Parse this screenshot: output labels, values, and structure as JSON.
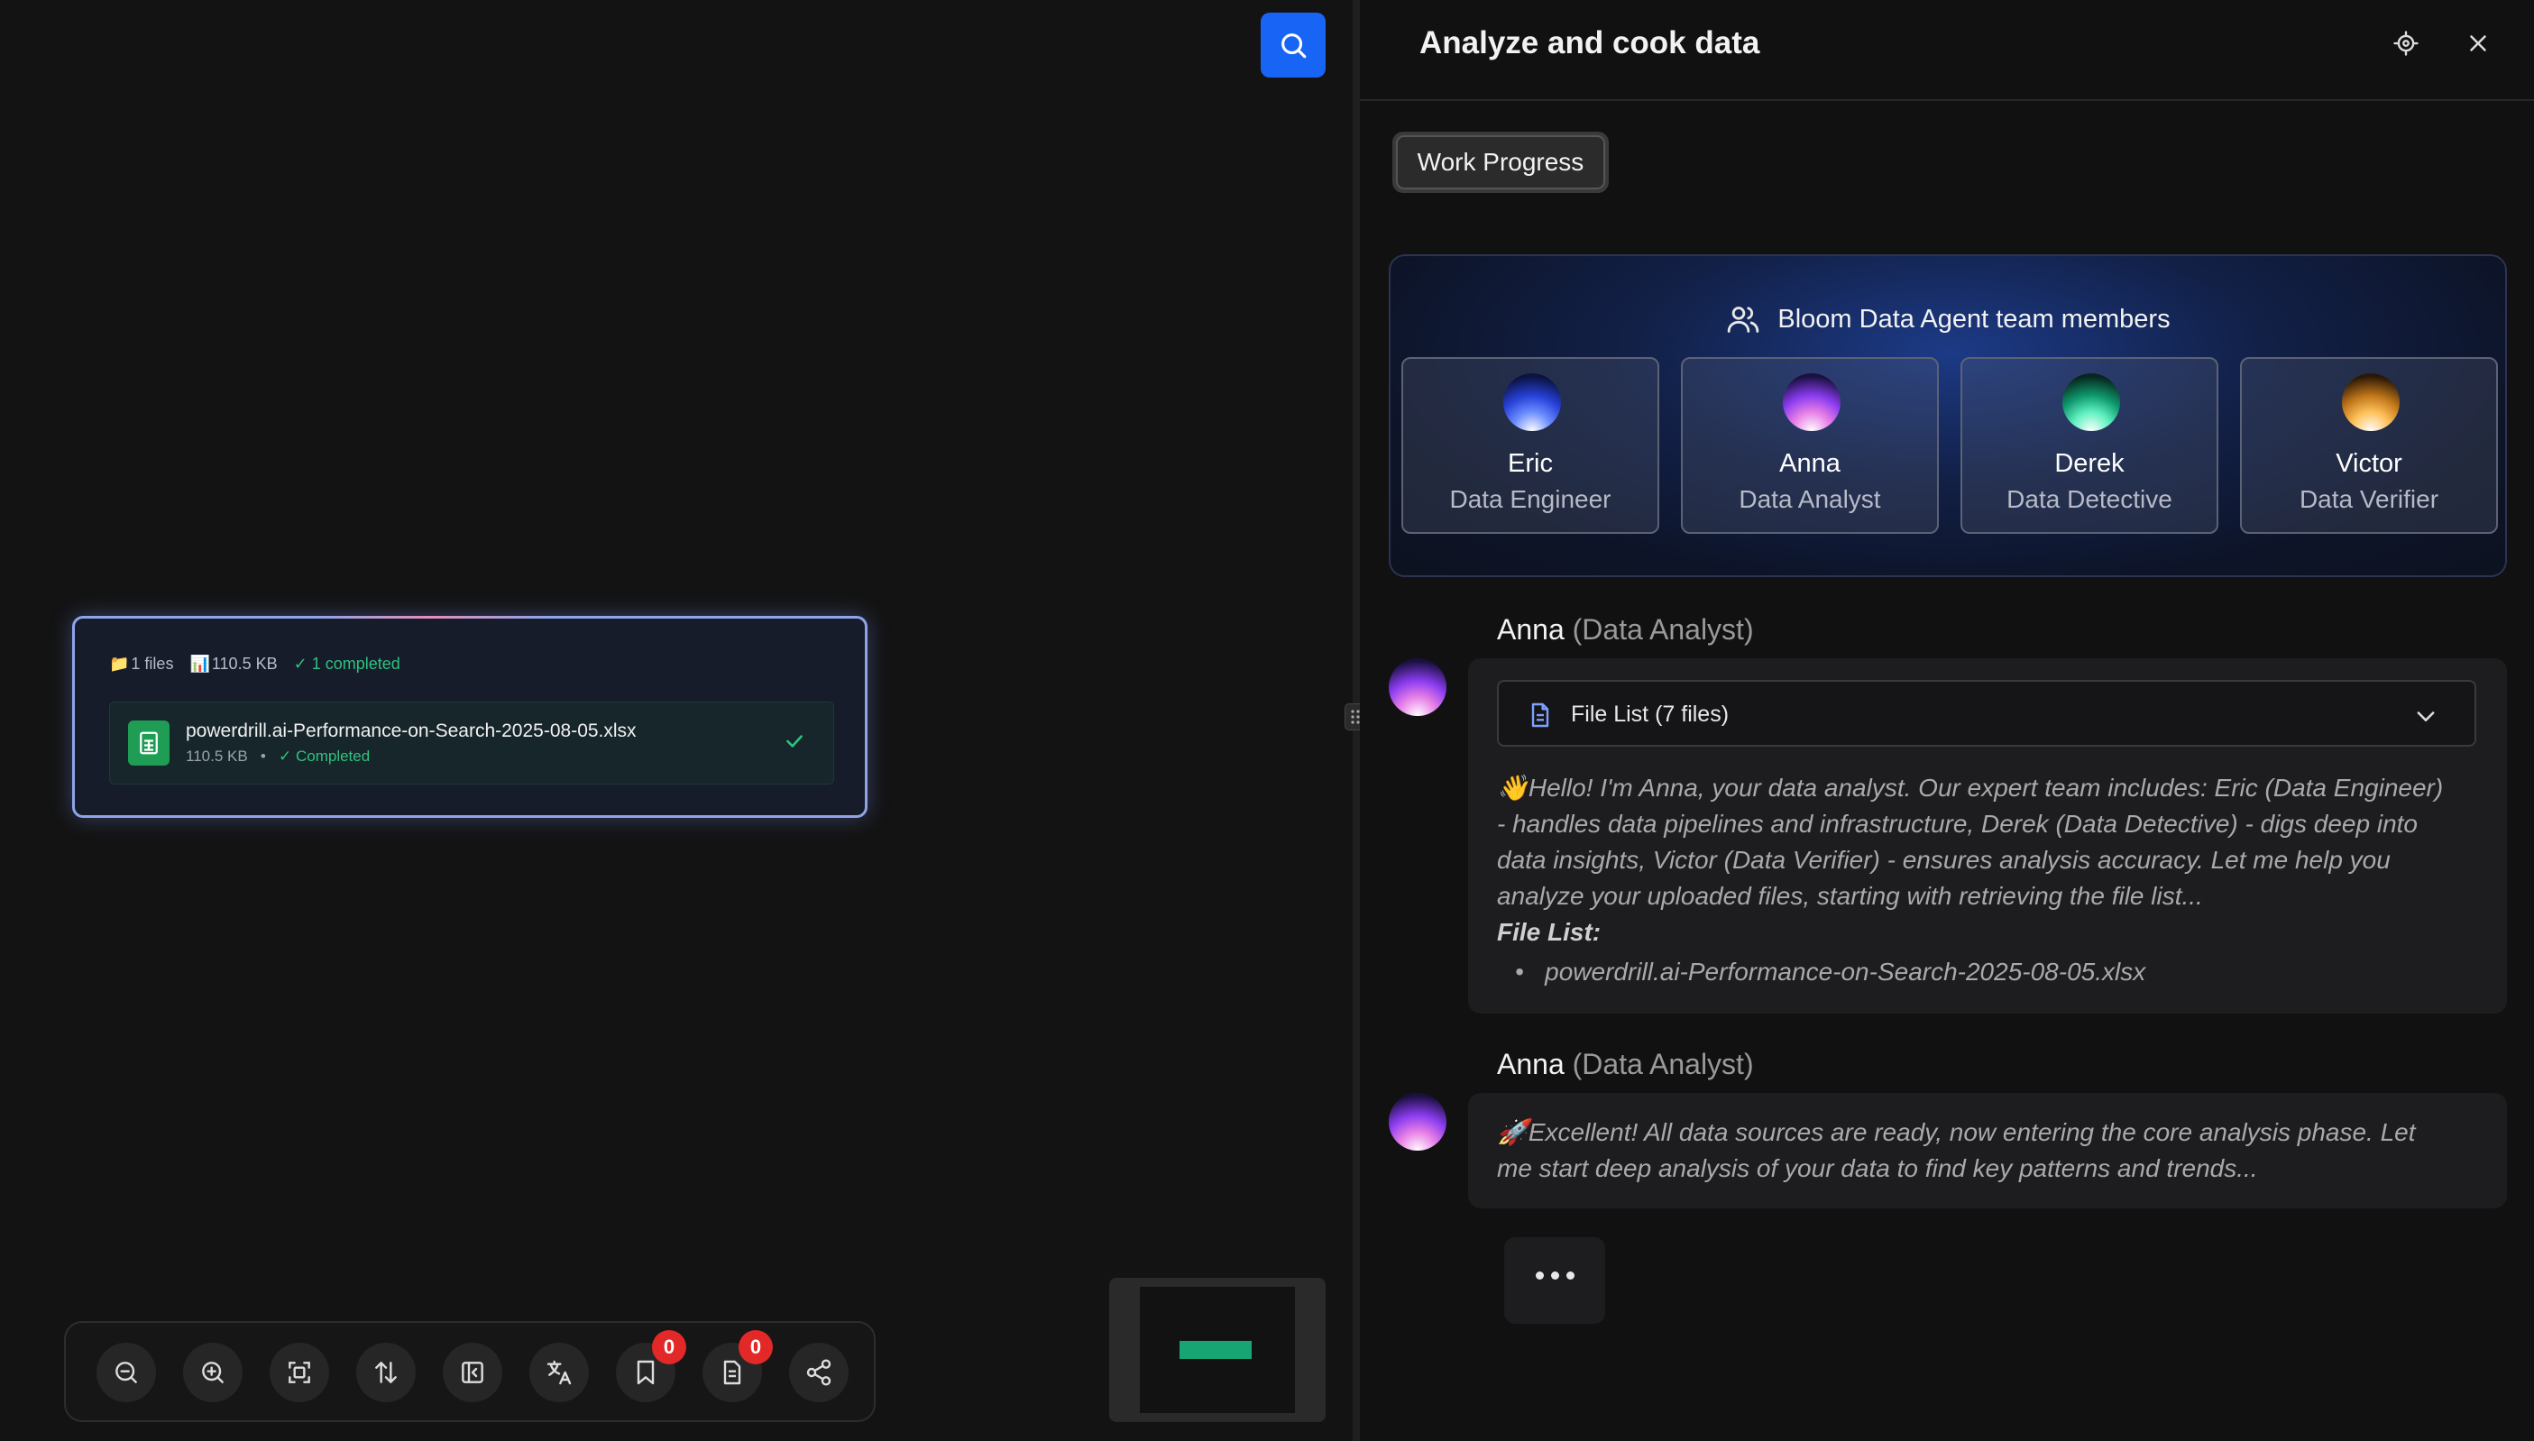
{
  "canvas": {
    "file_card": {
      "files_count": "1 files",
      "total_size": "110.5 KB",
      "completed": "✓ 1 completed",
      "file_name": "powerdrill.ai-Performance-on-Search-2025-08-05.xlsx",
      "file_size": "110.5 KB",
      "file_status": "✓ Completed"
    },
    "toolbar": {
      "bookmarks_count": "0",
      "notes_count": "0"
    }
  },
  "panel": {
    "title": "Analyze and cook data",
    "tab_label": "Work Progress",
    "team": {
      "title": "Bloom Data Agent team members",
      "members": [
        {
          "name": "Eric",
          "role": "Data Engineer"
        },
        {
          "name": "Anna",
          "role": "Data Analyst"
        },
        {
          "name": "Derek",
          "role": "Data Detective"
        },
        {
          "name": "Victor",
          "role": "Data Verifier"
        }
      ]
    },
    "messages": [
      {
        "author": "Anna",
        "role": "(Data Analyst)",
        "file_list_label": "File List (7 files)",
        "text_lines": [
          "👋Hello! I'm Anna, your data analyst. Our expert team includes: Eric (Data Engineer)",
          "- handles data pipelines and infrastructure, Derek (Data Detective) - digs deep into",
          "data insights, Victor (Data Verifier) - ensures analysis accuracy. Let me help you",
          "analyze your uploaded files, starting with retrieving the file list..."
        ],
        "list_heading": "File List:",
        "list_items": [
          "powerdrill.ai-Performance-on-Search-2025-08-05.xlsx"
        ]
      },
      {
        "author": "Anna",
        "role": "(Data Analyst)",
        "text_lines": [
          "🚀Excellent! All data sources are ready, now entering the core analysis phase. Let",
          "me start deep analysis of your data to find key patterns and trends..."
        ]
      }
    ]
  },
  "colors": {
    "accent": "#1864f5",
    "success": "#2ec27e",
    "badge": "#e32828",
    "panel_bg": "#111111"
  }
}
